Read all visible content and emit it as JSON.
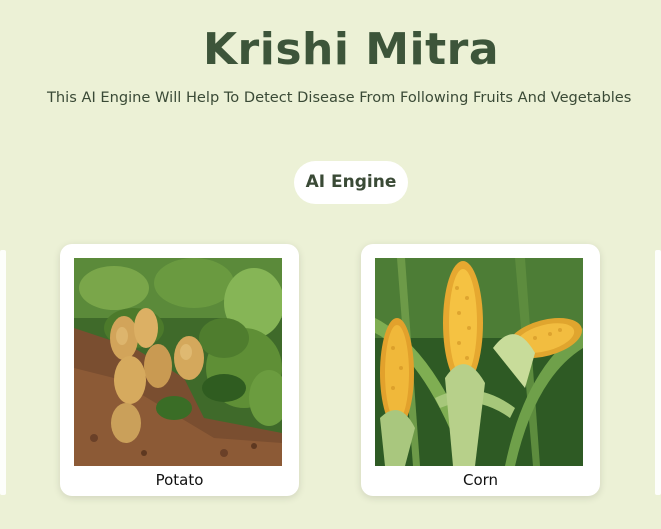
{
  "header": {
    "title": "Krishi Mitra",
    "subtitle": "This AI Engine Will Help To Detect Disease From Following Fruits And Vegetables"
  },
  "engine_button": {
    "label": "AI Engine"
  },
  "cards": [
    {
      "label": "Potato",
      "image": "potatoes-in-soil-photo"
    },
    {
      "label": "Corn",
      "image": "corn-cobs-photo"
    }
  ],
  "colors": {
    "background": "#ecf1d6",
    "title": "#3d553a",
    "card": "#ffffff"
  }
}
